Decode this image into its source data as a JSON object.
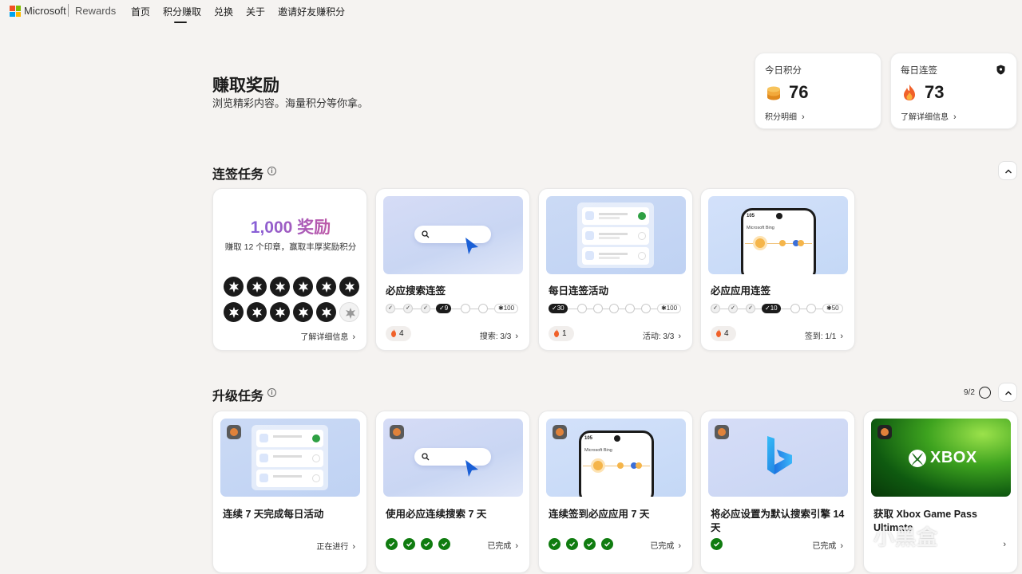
{
  "nav": {
    "brand": "Microsoft",
    "product": "Rewards",
    "links": [
      "首页",
      "积分赚取",
      "兑换",
      "关于",
      "邀请好友赚积分"
    ],
    "active_index": 1
  },
  "header": {
    "title": "赚取奖励",
    "subtitle": "浏览精彩内容。海量积分等你拿。"
  },
  "stats": {
    "today": {
      "label": "今日积分",
      "value": "76",
      "link": "积分明细"
    },
    "streak": {
      "label": "每日连签",
      "value": "73",
      "link": "了解详细信息"
    }
  },
  "streak_section": {
    "title": "连签任务",
    "promo": {
      "title": "1,000 奖励",
      "subtitle": "赚取 12 个印章，赢取丰厚奖励积分",
      "earned_stamps": 11,
      "total_stamps": 12,
      "link": "了解详细信息"
    },
    "cards": [
      {
        "title": "必应搜索连签",
        "current": "9",
        "goal": "100",
        "fire": "4",
        "status": "搜索: 3/3"
      },
      {
        "title": "每日连签活动",
        "current": "30",
        "goal": "100",
        "fire": "1",
        "status": "活动: 3/3"
      },
      {
        "title": "必应应用连签",
        "current": "10",
        "goal": "50",
        "fire": "4",
        "status": "签到: 1/1"
      }
    ]
  },
  "level_section": {
    "title": "升级任务",
    "count": "9/2",
    "cards": [
      {
        "title": "连续 7 天完成每日活动",
        "status": "正在进行",
        "checks": 0
      },
      {
        "title": "使用必应连续搜索 7 天",
        "status": "已完成",
        "checks": 4
      },
      {
        "title": "连续签到必应应用 7 天",
        "status": "已完成",
        "checks": 4
      },
      {
        "title": "将必应设置为默认搜索引擎 14 天",
        "status": "已完成",
        "checks": 1
      },
      {
        "title": "获取 Xbox Game Pass Ultimate",
        "status": "",
        "checks": 0
      }
    ]
  },
  "illustrations": {
    "phone_time": "105",
    "phone_brand": "Microsoft Bing",
    "xbox_logo": "XBOX"
  },
  "watermark": "小黑盒",
  "colors": {
    "background": "#f5f3f1",
    "success_green": "#107c10",
    "ms_red": "#f25022",
    "ms_green": "#7fba00",
    "ms_blue": "#00a4ef",
    "ms_yellow": "#ffb900"
  }
}
